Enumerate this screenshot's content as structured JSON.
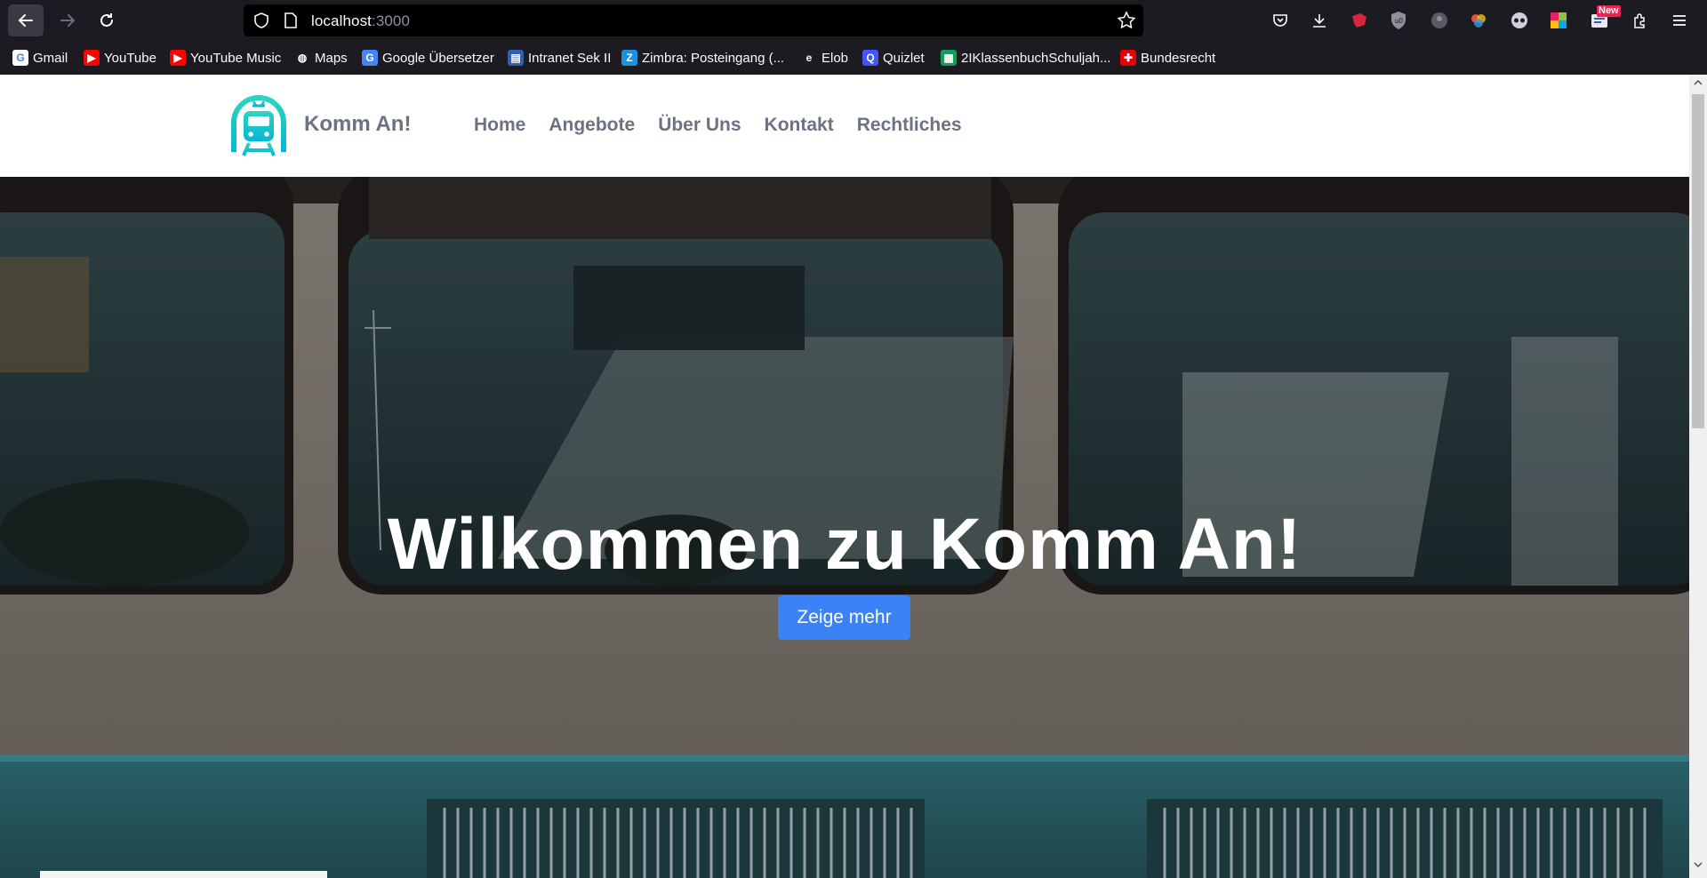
{
  "browser": {
    "url_host": "localhost",
    "url_port": ":3000",
    "bookmarks": [
      {
        "label": "Gmail",
        "icon": "gmail-icon",
        "color": "#ffffff",
        "glyph": "G"
      },
      {
        "label": "YouTube",
        "icon": "youtube-icon",
        "color": "#ff0000",
        "glyph": "▶"
      },
      {
        "label": "YouTube Music",
        "icon": "youtube-music-icon",
        "color": "#ff0000",
        "glyph": "▶"
      },
      {
        "label": "Maps",
        "icon": "globe-icon",
        "color": "#1c1b22",
        "glyph": "◍"
      },
      {
        "label": "Google Übersetzer",
        "icon": "translate-icon",
        "color": "#4285f4",
        "glyph": "G"
      },
      {
        "label": "Intranet Sek II",
        "icon": "intranet-icon",
        "color": "#2f5fb3",
        "glyph": "▤"
      },
      {
        "label": "Zimbra: Posteingang (...",
        "icon": "zimbra-icon",
        "color": "#1f8fe0",
        "glyph": "Z"
      },
      {
        "label": "Elob",
        "icon": "elob-icon",
        "color": "#1c1b22",
        "glyph": "e"
      },
      {
        "label": "Quizlet",
        "icon": "quizlet-icon",
        "color": "#4255ff",
        "glyph": "Q"
      },
      {
        "label": "2IKlassenbuchSchuljah...",
        "icon": "sheets-icon",
        "color": "#0f9d58",
        "glyph": "▦"
      },
      {
        "label": "Bundesrecht",
        "icon": "swiss-flag-icon",
        "color": "#e60000",
        "glyph": "✚"
      }
    ],
    "extension_badge": "New"
  },
  "site": {
    "brand": "Komm An!",
    "nav": [
      "Home",
      "Angebote",
      "Über Uns",
      "Kontakt",
      "Rechtliches"
    ],
    "hero_title": "Wilkommen zu Komm An!",
    "hero_button": "Zeige mehr"
  },
  "colors": {
    "accent": "#3b82f6",
    "logo_gradient_start": "#2dd4bf",
    "logo_gradient_end": "#06b6d4"
  }
}
